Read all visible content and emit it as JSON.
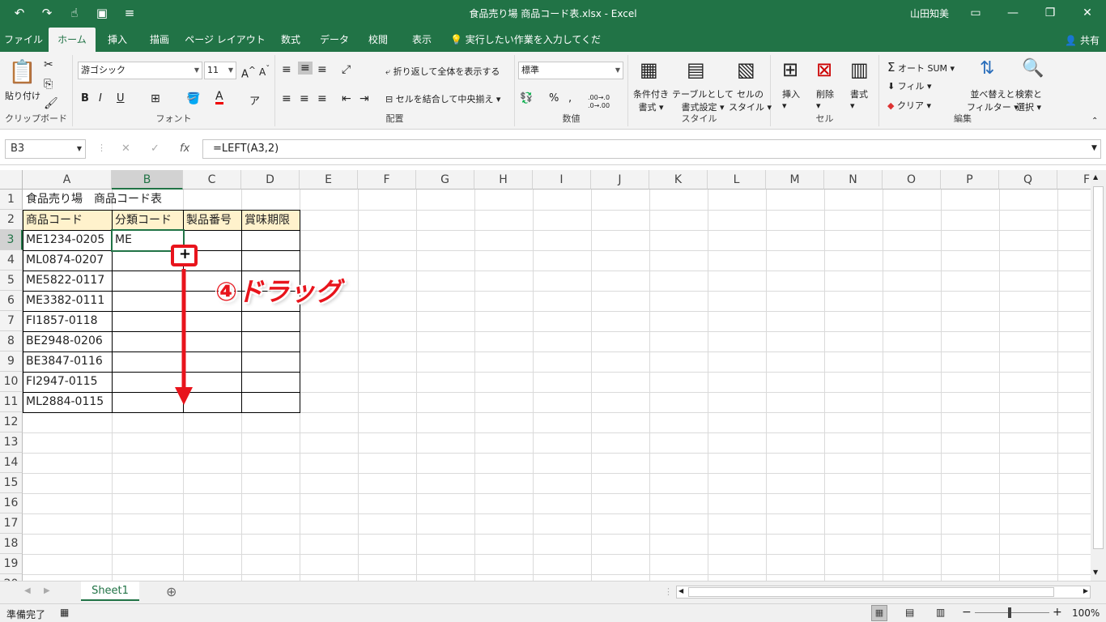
{
  "window": {
    "title": "食品売り場  商品コード表.xlsx  -  Excel",
    "user": "山田知美",
    "share": "共有"
  },
  "tabs": [
    "ファイル",
    "ホーム",
    "挿入",
    "描画",
    "ページ レイアウト",
    "数式",
    "データ",
    "校閲",
    "表示",
    "実行したい作業を入力してください"
  ],
  "ribbon": {
    "clipboard": {
      "paste": "貼り付け",
      "label": "クリップボード"
    },
    "font": {
      "name": "游ゴシック",
      "size": "11",
      "bold": "B",
      "italic": "I",
      "underline": "U",
      "label": "フォント"
    },
    "alignment": {
      "wrap": "折り返して全体を表示する",
      "merge": "セルを結合して中央揃え",
      "label": "配置"
    },
    "number": {
      "format": "標準",
      "percent": "%",
      "comma": ",",
      "inc": ".00→.0",
      "dec": ".0→.00",
      "label": "数値"
    },
    "styles": {
      "cond1": "条件付き",
      "cond2": "書式",
      "table1": "テーブルとして",
      "table2": "書式設定",
      "cell1": "セルの",
      "cell2": "スタイル",
      "label": "スタイル"
    },
    "cells": {
      "insert": "挿入",
      "delete": "削除",
      "format": "書式",
      "label": "セル"
    },
    "editing": {
      "autosum": "オート SUM",
      "fill": "フィル",
      "clear": "クリア",
      "sort1": "並べ替えと",
      "sort2": "フィルター",
      "find1": "検索と",
      "find2": "選択",
      "label": "編集"
    }
  },
  "formula_bar": {
    "name_box": "B3",
    "fx": "fx",
    "formula": "=LEFT(A3,2)"
  },
  "columns": [
    "A",
    "B",
    "C",
    "D",
    "E",
    "F",
    "G",
    "H",
    "I",
    "J",
    "K",
    "L",
    "M",
    "N",
    "O",
    "P",
    "Q",
    "F"
  ],
  "rows": [
    "1",
    "2",
    "3",
    "4",
    "5",
    "6",
    "7",
    "8",
    "9",
    "10",
    "11",
    "12",
    "13",
    "14",
    "15",
    "16",
    "17",
    "18",
    "19",
    "20"
  ],
  "cells": {
    "a1": "食品売り場　商品コード表",
    "headers": [
      "商品コード",
      "分類コード",
      "製品番号",
      "賞味期限"
    ],
    "codes": [
      "ME1234-0205",
      "ML0874-0207",
      "ME5822-0117",
      "ME3382-0111",
      "FI1857-0118",
      "BE2948-0206",
      "BE3847-0116",
      "FI2947-0115",
      "ML2884-0115"
    ],
    "b3": "ME"
  },
  "annotation": {
    "text": "④ドラッグ",
    "accent": "#e8141c"
  },
  "sheet_tab": "Sheet1",
  "status": {
    "ready": "準備完了",
    "zoom": "100%"
  },
  "colors": {
    "excel_green": "#217346",
    "header_fill": "#fff2cc"
  }
}
